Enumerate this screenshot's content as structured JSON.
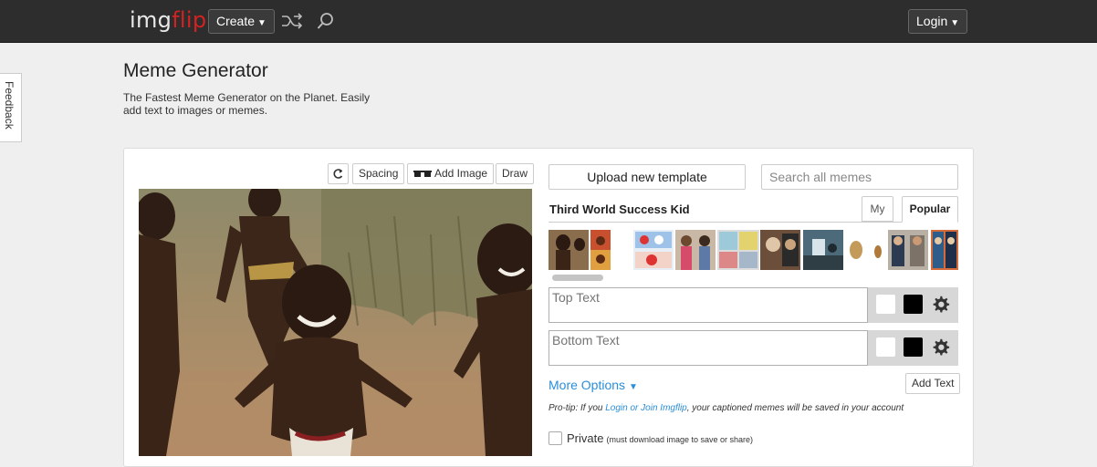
{
  "header": {
    "logo_part1": "img",
    "logo_part2": "flip",
    "create_label": "Create",
    "login_label": "Login",
    "icons": [
      "shuffle-icon",
      "search-icon",
      "chevron-down-icon"
    ]
  },
  "feedback_label": "Feedback",
  "page": {
    "title": "Meme Generator",
    "subtitle": "The Fastest Meme Generator on the Planet. Easily add text to images or memes."
  },
  "editor_toolbar": {
    "spacing_label": "Spacing",
    "add_image_label": "Add Image",
    "draw_label": "Draw",
    "icons": [
      "rotate-icon",
      "sunglasses-icon"
    ]
  },
  "template_panel": {
    "upload_label": "Upload new template",
    "search_placeholder": "Search all memes",
    "selected_template": "Third World Success Kid",
    "tabs": {
      "my": "My",
      "popular": "Popular"
    },
    "active_tab": "Popular"
  },
  "text_boxes": [
    {
      "placeholder": "Top Text"
    },
    {
      "placeholder": "Bottom Text"
    }
  ],
  "options": {
    "more_options_label": "More Options",
    "add_text_label": "Add Text",
    "protip_prefix": "Pro-tip: If you ",
    "protip_link": "Login or Join Imgflip",
    "protip_suffix": ", your captioned memes will be saved in your account",
    "private_label": "Private",
    "private_note": "(must download image to save or share)"
  },
  "colors": {
    "topbar_bg": "#2d2d2d",
    "logo_accent": "#d22222",
    "link_blue": "#2a8ed9"
  }
}
